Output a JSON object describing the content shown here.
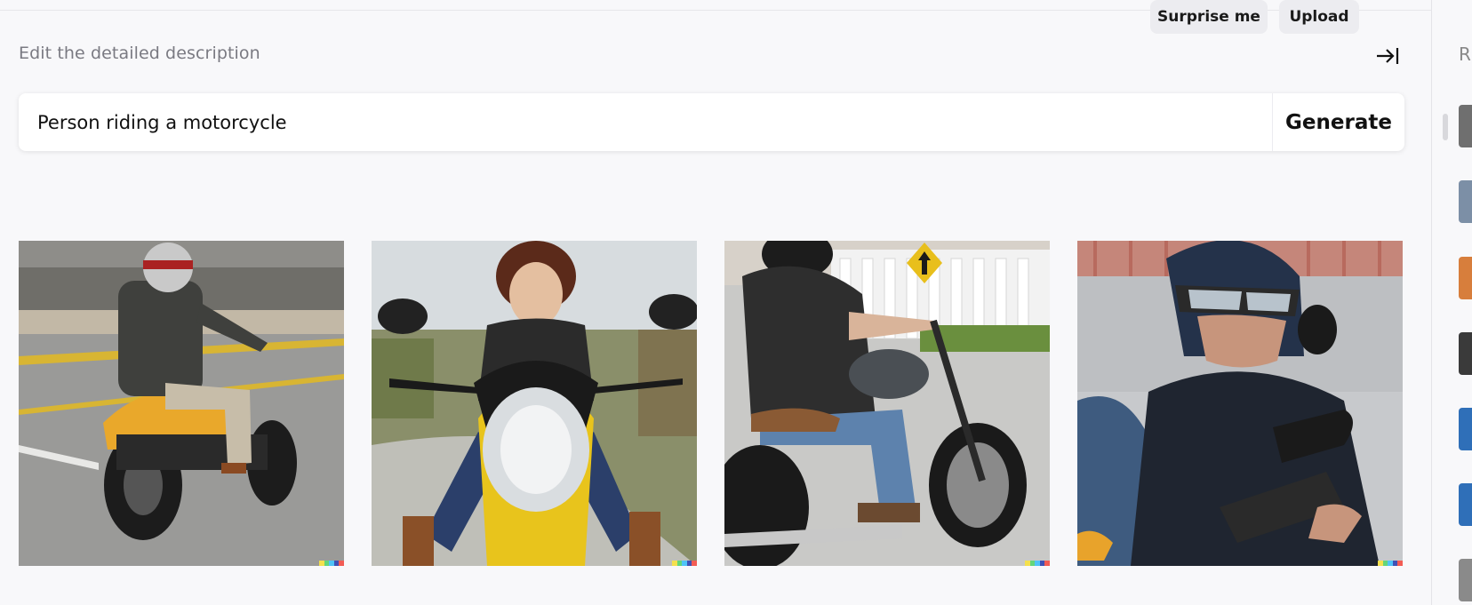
{
  "header": {
    "label": "Edit the detailed description",
    "surprise_label": "Surprise me",
    "upload_label": "Upload"
  },
  "prompt": {
    "value": "Person riding a motorcycle",
    "generate_label": "Generate"
  },
  "results": [
    {
      "alt": "Person riding a motorcycle 1"
    },
    {
      "alt": "Person riding a motorcycle 2"
    },
    {
      "alt": "Person riding a motorcycle 3"
    },
    {
      "alt": "Person riding a motorcycle 4"
    }
  ],
  "sidebar": {
    "header_letter": "R"
  },
  "colors": {
    "background": "#f8f8fa",
    "pill": "#ececf0",
    "watermark": [
      "#f4e04d",
      "#64d57a",
      "#4fc3f7",
      "#3f51b5",
      "#f25c54"
    ]
  }
}
